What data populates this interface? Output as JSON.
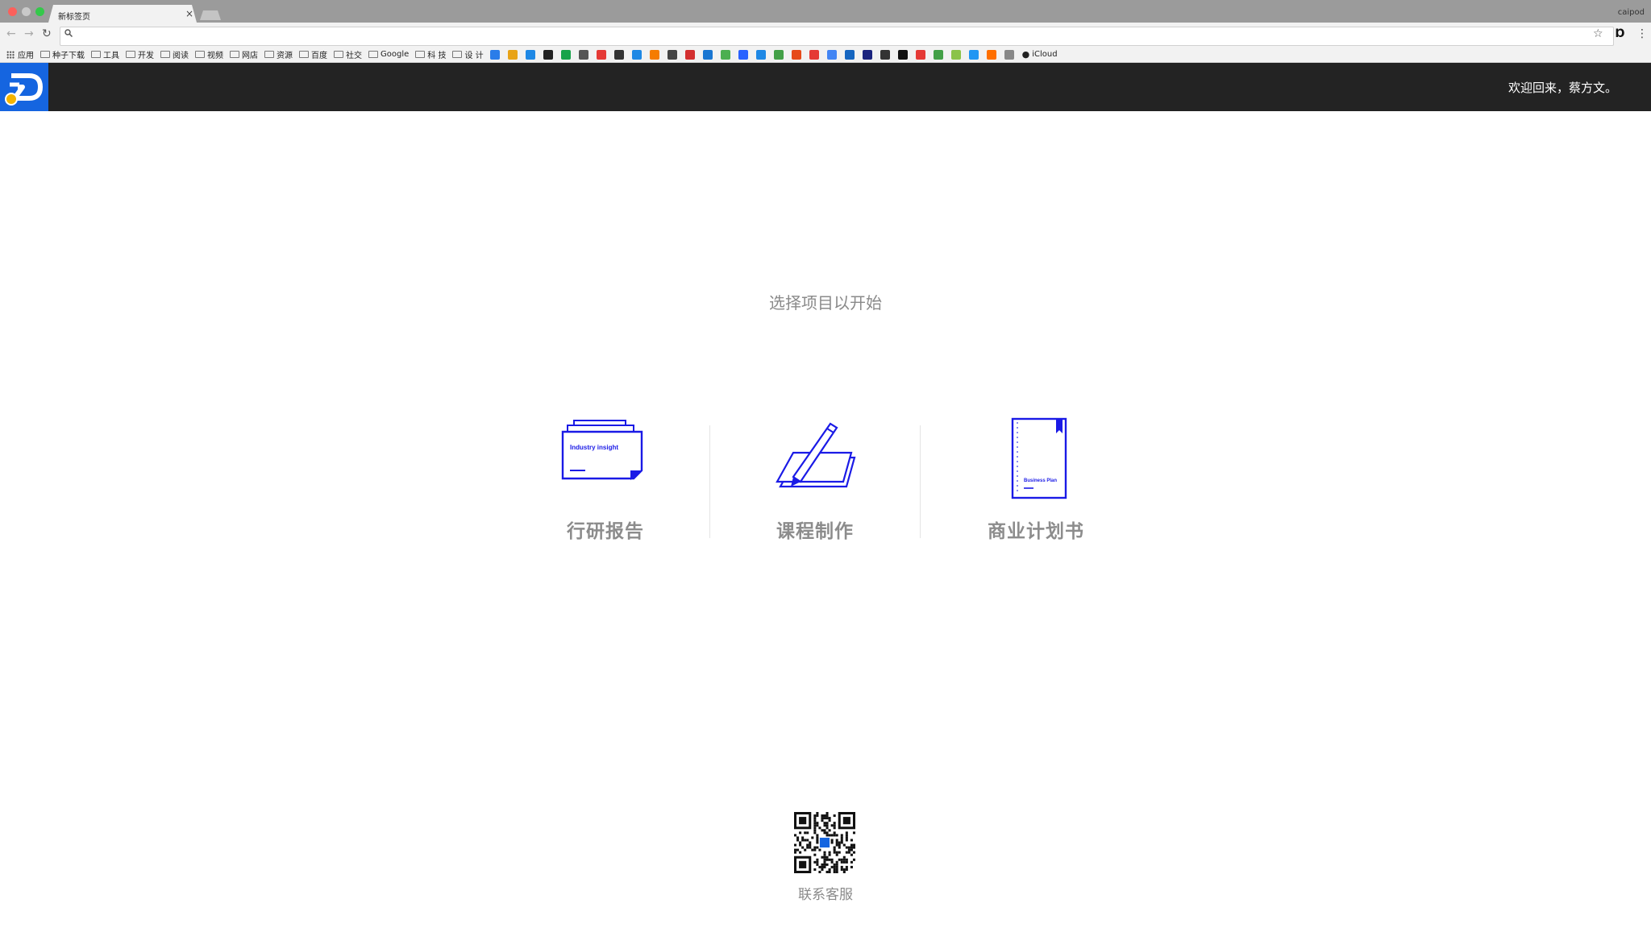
{
  "browser": {
    "tab_title": "新标签页",
    "tab_close": "×",
    "profile": "caipod",
    "omnibox_placeholder": "",
    "bookmarks": {
      "apps": "应用",
      "folders": [
        "种子下载",
        "工具",
        "开发",
        "阅读",
        "视频",
        "网店",
        "资源",
        "百度",
        "社交",
        "Google",
        "科 技",
        "设 计"
      ],
      "favicon_colors": [
        "#2b7de9",
        "#e8a317",
        "#1e88e5",
        "#222222",
        "#17a34a",
        "#555555",
        "#e53935",
        "#333333",
        "#1e88e5",
        "#f57c00",
        "#444444",
        "#d32f2f",
        "#1976d2",
        "#4caf50",
        "#2962ff",
        "#1e88e5",
        "#43a047",
        "#e64a19",
        "#e53935",
        "#4285f4",
        "#1565c0",
        "#1a237e",
        "#333333",
        "#111111",
        "#e53935",
        "#43a047",
        "#8bc34a",
        "#2196f3",
        "#ff6f00",
        "#888888"
      ],
      "icloud": "iCloud"
    }
  },
  "app": {
    "welcome": "欢迎回来，蔡方文。",
    "prompt": "选择项目以开始",
    "cards": [
      {
        "label": "行研报告",
        "icon_text": "Industry insight"
      },
      {
        "label": "课程制作"
      },
      {
        "label": "商业计划书",
        "icon_text": "Business Plan"
      }
    ],
    "contact": "联系客服",
    "accent": "#1a1ae6",
    "header_bg": "#232323",
    "logo_bg": "#1565e0"
  }
}
